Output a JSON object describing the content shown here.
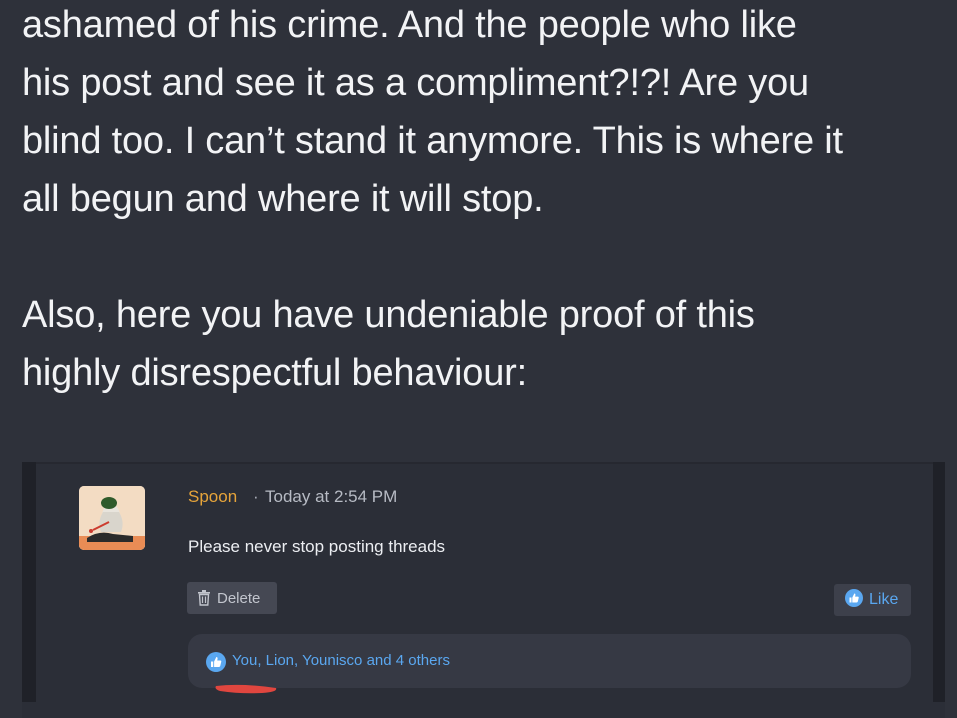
{
  "post": {
    "lines": [
      "ashamed of his crime. And the people who like",
      "his post and see it as a compliment?!?! Are you",
      "blind too. I can’t stand it anymore. This is where it",
      "all begun and where it will stop.",
      "Also, here you have undeniable proof of this",
      "highly disrespectful behaviour:"
    ]
  },
  "comment": {
    "username": "Spoon",
    "separator": "·",
    "timestamp": "Today at 2:54 PM",
    "text": "Please never stop posting threads",
    "delete_label": "Delete",
    "like_label": "Like",
    "reactions_text": "You, Lion, Younisco and 4 others"
  },
  "colors": {
    "background": "#2e313a",
    "username": "#e6a43a",
    "accent_blue": "#5aa7f0",
    "scribble_red": "#e0463f"
  },
  "icons": {
    "delete": "trash-icon",
    "like": "thumbs-up-icon",
    "reactions": "thumbs-up-icon"
  }
}
